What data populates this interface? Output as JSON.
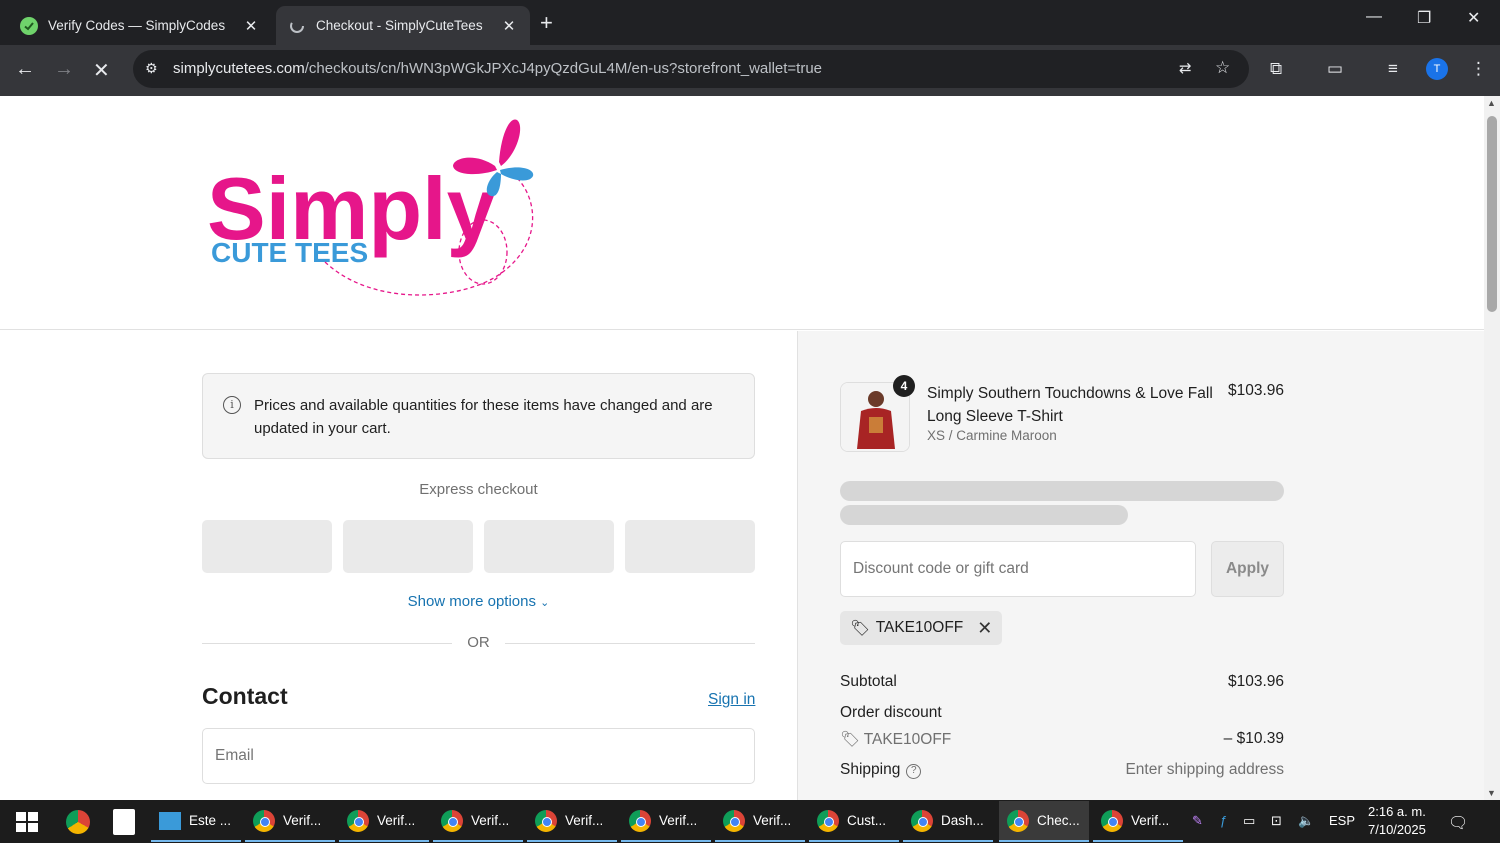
{
  "browser": {
    "tabs": [
      {
        "title": "Verify Codes — SimplyCodes",
        "favicon": "simplycodes-icon",
        "active": false
      },
      {
        "title": "Checkout - SimplyCuteTees",
        "favicon": "loading-icon",
        "active": true
      }
    ],
    "url_host": "simplycutetees.com",
    "url_path": "/checkouts/cn/hWN3pWGkJPXcJ4pyQzdGuL4M/en-us?storefront_wallet=true",
    "profile_initial": "T"
  },
  "logo": {
    "word": "Simply",
    "tagline": "CUTE TEES",
    "pink": "#e6168a",
    "blue": "#3a9ad9"
  },
  "notice": {
    "text": "Prices and available quantities for these items have changed and are updated in your cart."
  },
  "express": {
    "label": "Express checkout",
    "show_more": "Show more options",
    "or": "OR"
  },
  "contact": {
    "heading": "Contact",
    "sign_in": "Sign in",
    "email_placeholder": "Email"
  },
  "cart": {
    "quantity": "4",
    "product_name": "Simply Southern Touchdowns & Love Fall Long Sleeve T-Shirt",
    "variant": "XS / Carmine Maroon",
    "price": "$103.96"
  },
  "discount": {
    "placeholder": "Discount code or gift card",
    "apply": "Apply",
    "applied_code": "TAKE10OFF"
  },
  "summary": {
    "subtotal_label": "Subtotal",
    "subtotal_value": "$103.96",
    "order_discount_label": "Order discount",
    "discount_code": "TAKE10OFF",
    "discount_value": "– $10.39",
    "shipping_label": "Shipping",
    "shipping_value": "Enter shipping address"
  },
  "taskbar": {
    "apps": [
      "Este ...",
      "Verif...",
      "Verif...",
      "Verif...",
      "Verif...",
      "Verif...",
      "Verif...",
      "Cust...",
      "Dash...",
      "Chec...",
      "Verif..."
    ],
    "language": "ESP",
    "time": "2:16 a. m.",
    "date": "7/10/2025"
  },
  "colors": {
    "link": "#1773b0",
    "accent_pink": "#e6168a"
  }
}
